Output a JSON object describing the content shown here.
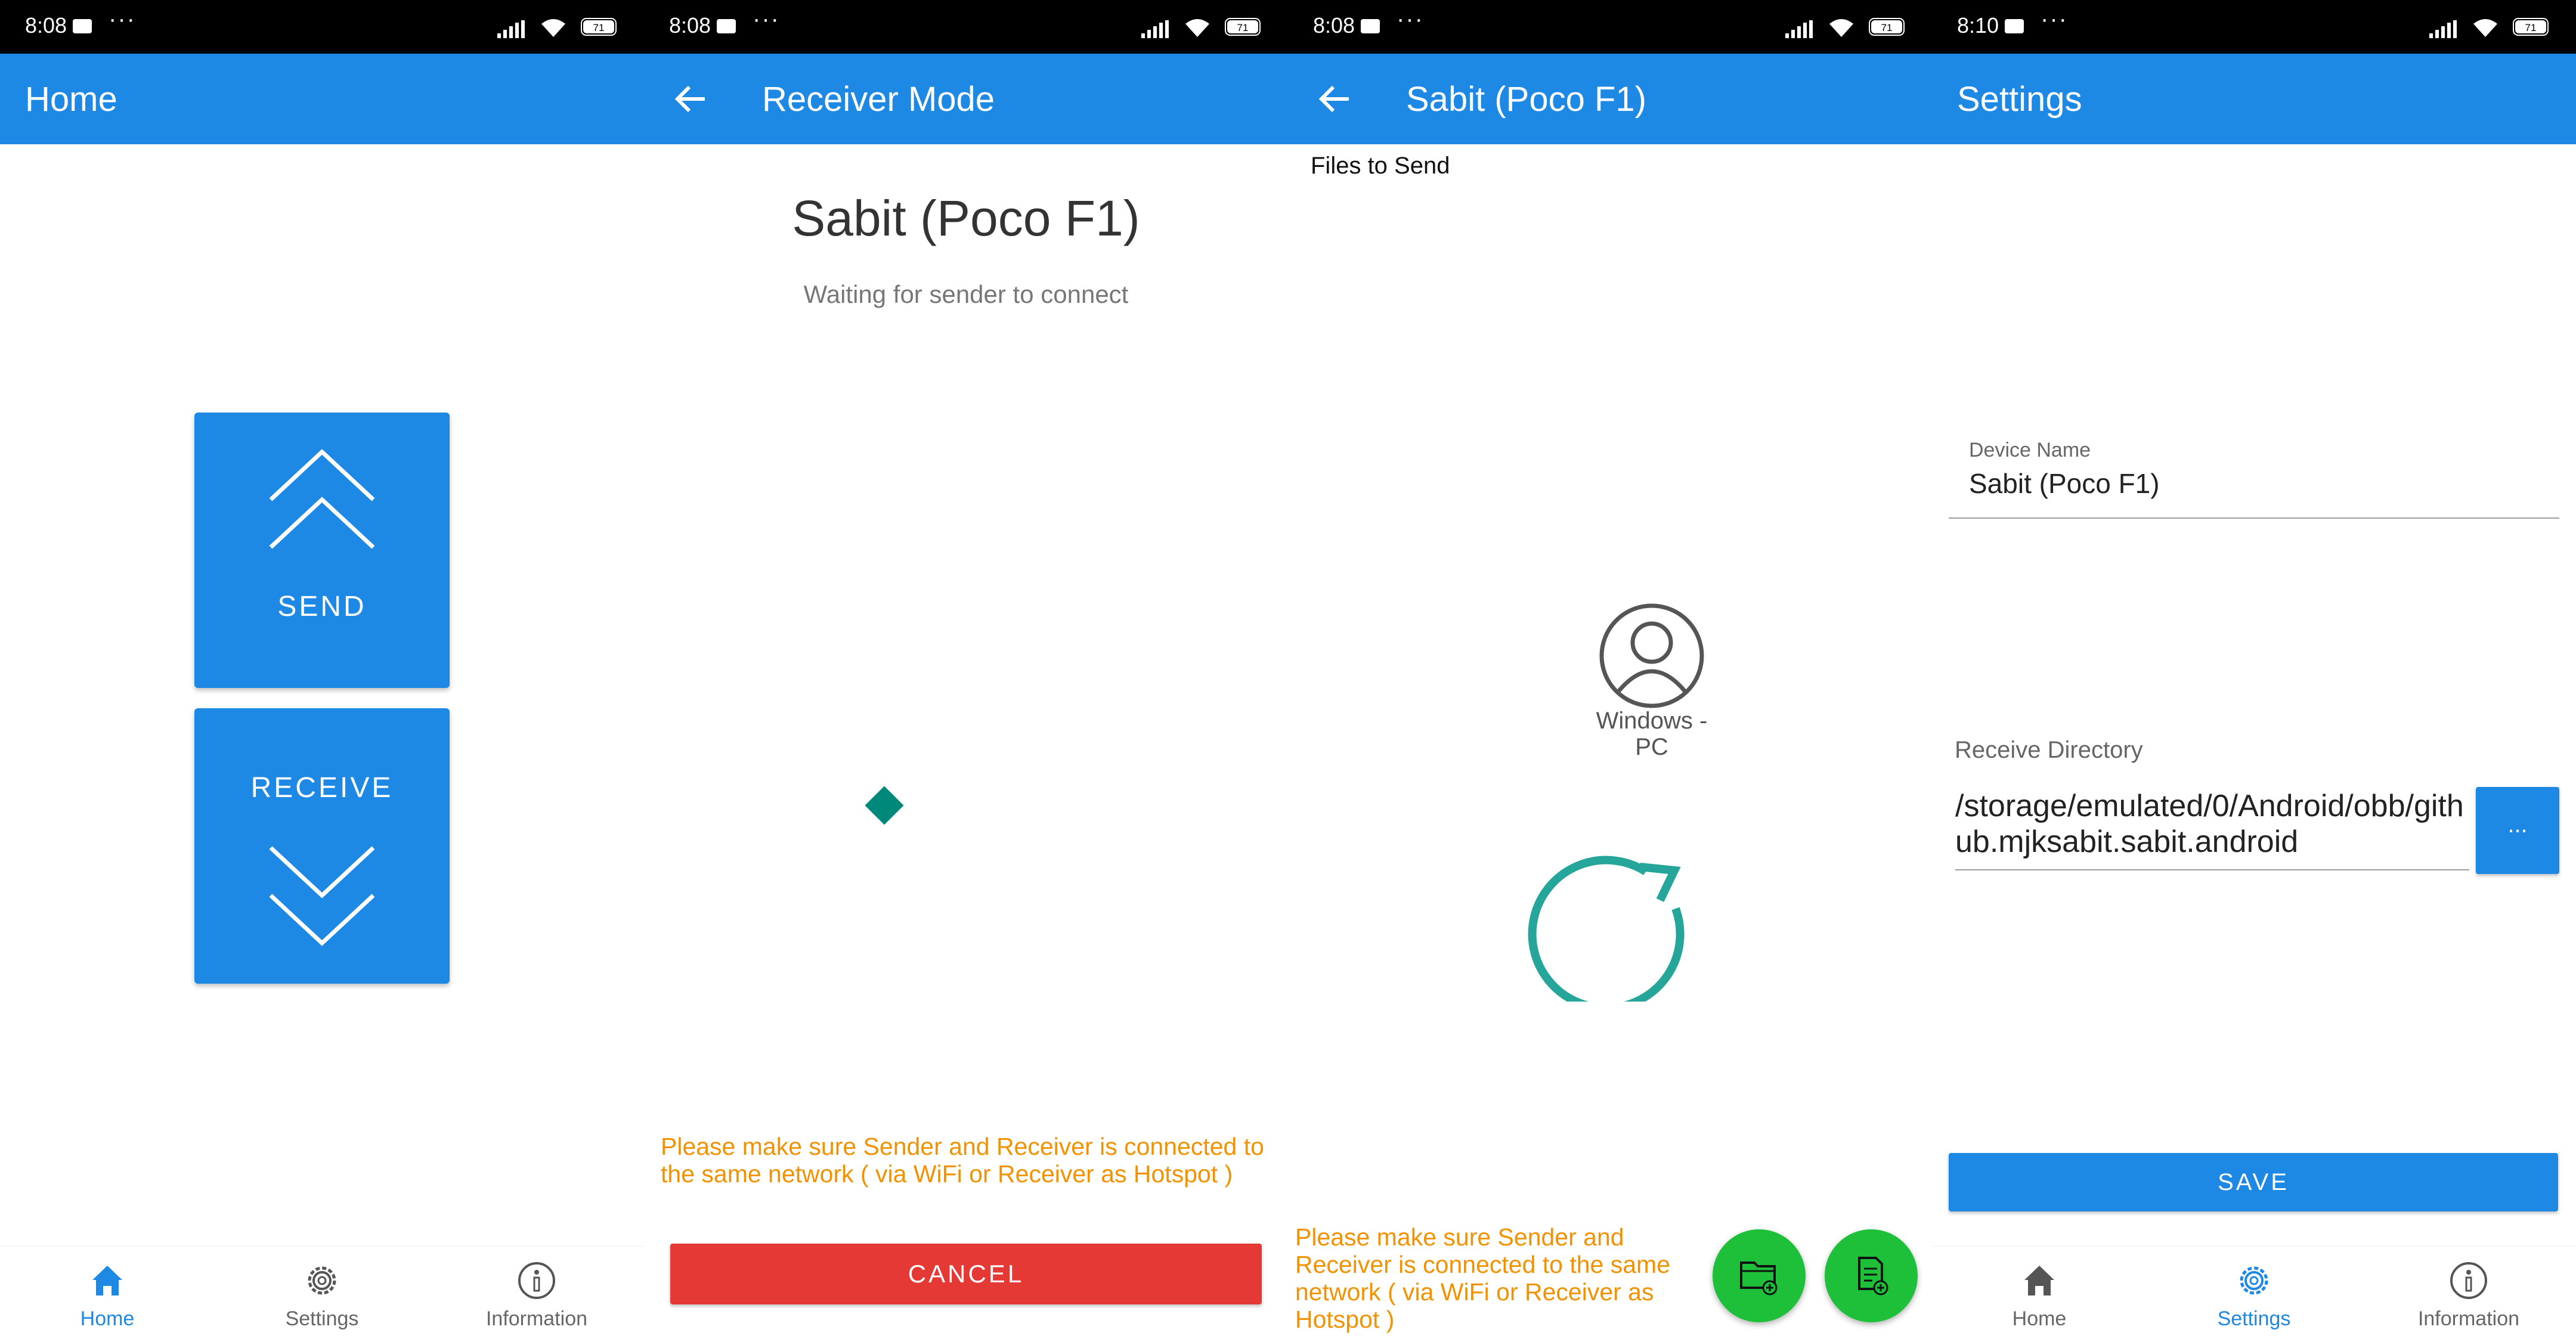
{
  "colors": {
    "primary": "#1e88e5",
    "danger": "#e53935",
    "warning": "#f39200",
    "accent": "#00897b",
    "fab": "#1ec03a"
  },
  "status_times": [
    "8:08",
    "8:08",
    "8:08",
    "8:10"
  ],
  "battery": "71",
  "home": {
    "title": "Home",
    "send_label": "SEND",
    "receive_label": "RECEIVE"
  },
  "receiver": {
    "title": "Receiver Mode",
    "device_name": "Sabit (Poco F1)",
    "waiting": "Waiting for sender to connect",
    "warning": "Please make sure Sender and Receiver is connected to the same network ( via WiFi or Receiver as Hotspot )",
    "cancel_label": "CANCEL"
  },
  "sender": {
    "title": "Sabit (Poco F1)",
    "files_label": "Files to Send",
    "peer_name": "Windows -PC",
    "warning": "Please make sure Sender and Receiver is connected to the same network ( via WiFi or Receiver as Hotspot )",
    "icons": [
      "refresh-icon",
      "add-folder-icon",
      "add-file-icon"
    ]
  },
  "settings": {
    "title": "Settings",
    "device_name_label": "Device Name",
    "device_name_value": "Sabit (Poco F1)",
    "receive_dir_label": "Receive Directory",
    "receive_dir_value": "/storage/emulated/0/Android/obb/github.mjksabit.sabit.android",
    "browse_label": "...",
    "save_label": "SAVE"
  },
  "nav": {
    "home": "Home",
    "settings": "Settings",
    "information": "Information"
  }
}
